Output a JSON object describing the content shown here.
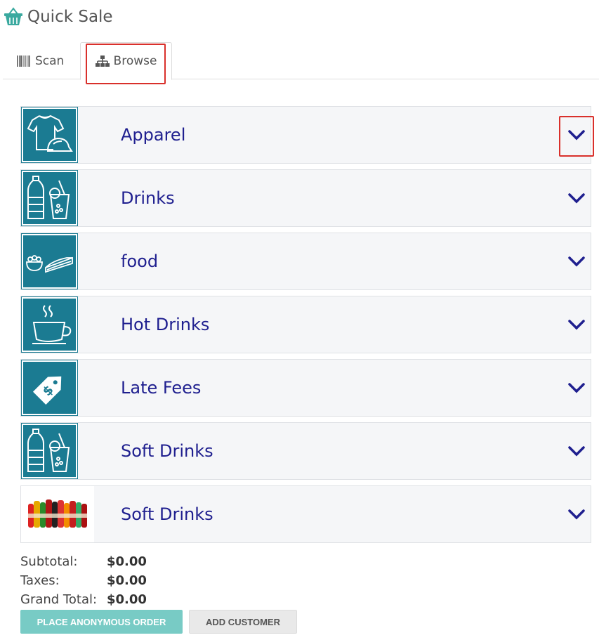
{
  "app": {
    "title": "Quick Sale",
    "icon": "basket-icon"
  },
  "tabs": [
    {
      "label": "Scan",
      "icon": "barcode-icon",
      "active": false
    },
    {
      "label": "Browse",
      "icon": "sitemap-icon",
      "active": true
    }
  ],
  "categories": [
    {
      "name": "Apparel",
      "icon": "tshirt-cap-icon"
    },
    {
      "name": "Drinks",
      "icon": "bottle-glass-icon"
    },
    {
      "name": "food",
      "icon": "salad-sandwich-icon"
    },
    {
      "name": "Hot Drinks",
      "icon": "coffee-cup-icon"
    },
    {
      "name": "Late Fees",
      "icon": "price-tag-icon"
    },
    {
      "name": "Soft Drinks",
      "icon": "bottle-glass-icon"
    },
    {
      "name": "Soft Drinks",
      "icon": "soda-bottles-photo"
    }
  ],
  "totals": {
    "subtotal_label": "Subtotal:",
    "subtotal": "$0.00",
    "taxes_label": "Taxes:",
    "taxes": "$0.00",
    "grand_label": "Grand Total:",
    "grand": "$0.00"
  },
  "buttons": {
    "place_order": "PLACE ANONYMOUS ORDER",
    "add_customer": "ADD CUSTOMER"
  },
  "colors": {
    "accent": "#1b7b92",
    "category_text": "#1f1f8f",
    "primary_button": "#78cbc5",
    "highlight": "#d9302b"
  }
}
